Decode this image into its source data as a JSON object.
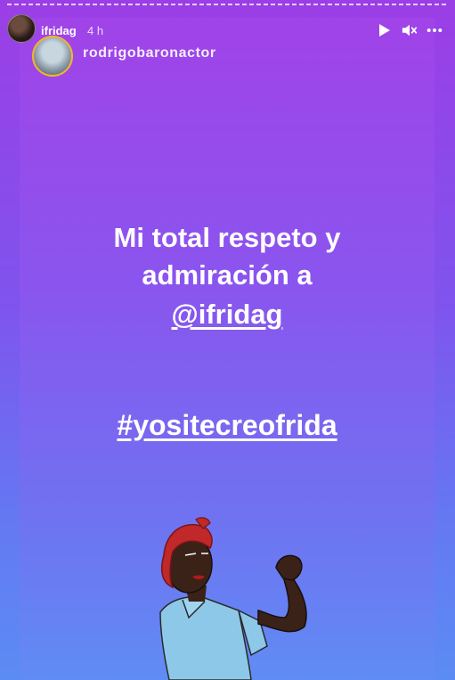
{
  "header": {
    "username": "ifridag",
    "time": "4 h"
  },
  "repost": {
    "username": "rodrigobaronactor"
  },
  "story": {
    "line1": "Mi total respeto y",
    "line2": "admiración a",
    "mention": "@ifridag",
    "hashtag": "#yositecreofrida"
  },
  "icons": {
    "play": "play-icon",
    "mute": "mute-icon",
    "more": "more-options-icon"
  }
}
